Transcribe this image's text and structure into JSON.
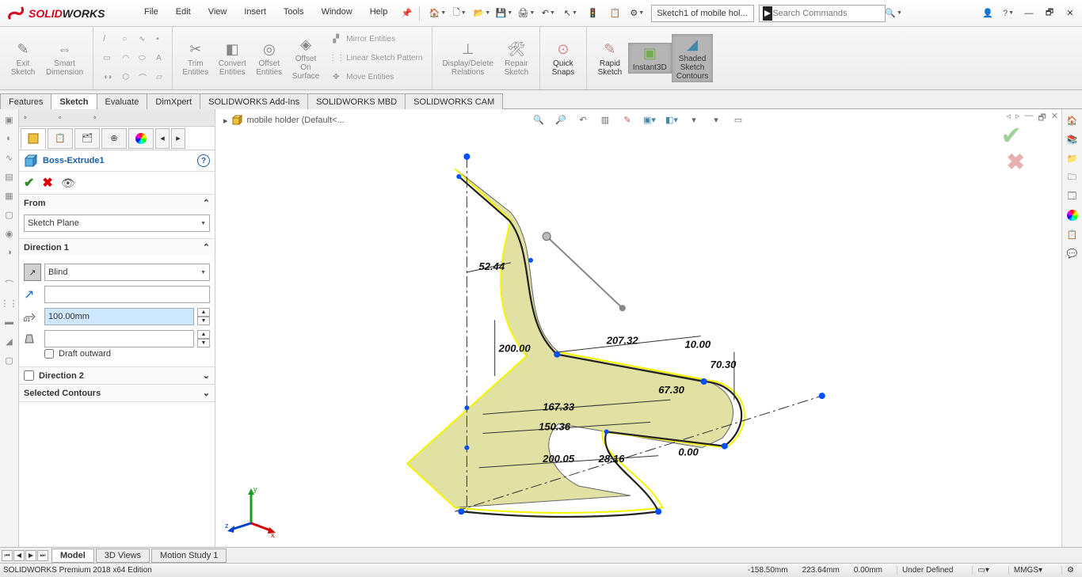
{
  "app": {
    "name_solid": "SOLID",
    "name_works": "WORKS"
  },
  "menu": [
    "File",
    "Edit",
    "View",
    "Insert",
    "Tools",
    "Window",
    "Help"
  ],
  "header": {
    "doc_name": "Sketch1 of mobile hol...",
    "search_placeholder": "Search Commands"
  },
  "ribbon": {
    "exit_sketch": "Exit\nSketch",
    "smart_dim": "Smart\nDimension",
    "trim": "Trim\nEntities",
    "convert": "Convert\nEntities",
    "offset_ent": "Offset\nEntities",
    "offset_surf": "Offset\nOn\nSurface",
    "mirror": "Mirror Entities",
    "linear": "Linear Sketch Pattern",
    "move": "Move Entities",
    "disp_del": "Display/Delete\nRelations",
    "repair": "Repair\nSketch",
    "quick_snaps": "Quick\nSnaps",
    "rapid": "Rapid\nSketch",
    "instant3d": "Instant3D",
    "shaded": "Shaded\nSketch\nContours"
  },
  "cm_tabs": [
    "Features",
    "Sketch",
    "Evaluate",
    "DimXpert",
    "SOLIDWORKS Add-Ins",
    "SOLIDWORKS MBD",
    "SOLIDWORKS CAM"
  ],
  "cm_active": 1,
  "breadcrumb": "mobile holder  (Default<...",
  "pm": {
    "title": "Boss-Extrude1",
    "from_label": "From",
    "from_value": "Sketch Plane",
    "dir1_label": "Direction 1",
    "dir1_end": "Blind",
    "depth": "100.00mm",
    "draft_outward": "Draft outward",
    "dir2_label": "Direction 2",
    "sel_contours": "Selected Contours"
  },
  "dims": {
    "d1": "52.44",
    "d2": "200.00",
    "d3": "207.32",
    "d4": "10.00",
    "d5": "70.30",
    "d6": "67.30",
    "d7": "167.33",
    "d8": "150.36",
    "d9": "200.05",
    "d10": "28.16",
    "d11": "0.00"
  },
  "btabs": [
    "Model",
    "3D Views",
    "Motion Study 1"
  ],
  "btab_active": 0,
  "status": {
    "edition": "SOLIDWORKS Premium 2018 x64 Edition",
    "x": "-158.50mm",
    "y": "223.64mm",
    "z": "0.00mm",
    "state": "Under Defined",
    "units": "MMGS"
  },
  "triad": {
    "x": "x",
    "y": "y",
    "z": "z"
  }
}
